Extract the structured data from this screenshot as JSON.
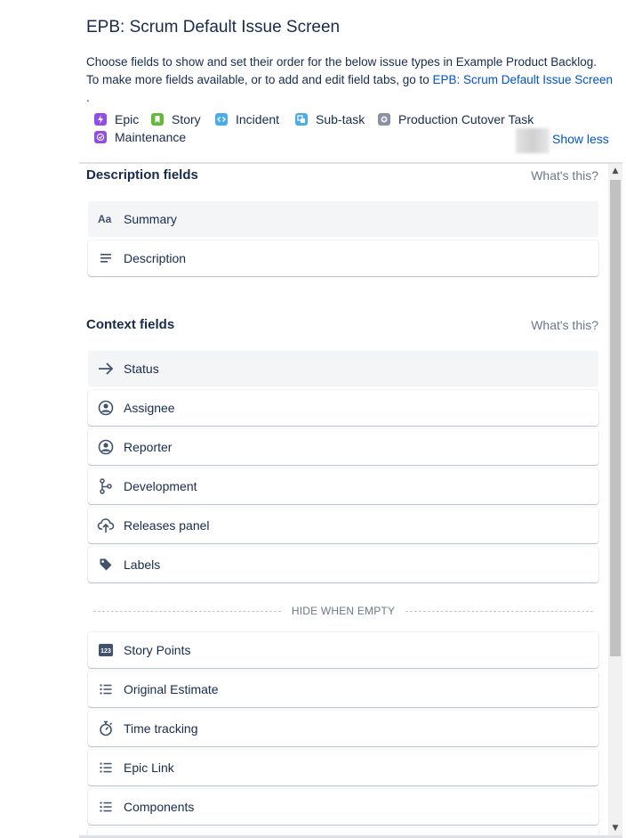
{
  "header": {
    "title": "EPB: Scrum Default Issue Screen",
    "intro_line1": "Choose fields to show and set their order for the below issue types in Example Product Backlog.",
    "intro_line2_prefix": "To make more fields available, or to add and edit field tabs, go to ",
    "intro_link": "EPB: Scrum Default Issue Screen",
    "intro_suffix": "."
  },
  "issue_types": [
    {
      "label": "Epic",
      "icon": "epic-icon",
      "color": "#904ee2"
    },
    {
      "label": "Story",
      "icon": "story-icon",
      "color": "#63ba3c"
    },
    {
      "label": "Incident",
      "icon": "incident-icon",
      "color": "#4bade8"
    },
    {
      "label": "Sub-task",
      "icon": "subtask-icon",
      "color": "#4bade8"
    },
    {
      "label": "Production Cutover Task",
      "icon": "task-icon",
      "color": "#8993a4"
    },
    {
      "label": "Maintenance",
      "icon": "maintenance-icon",
      "color": "#904ee2"
    }
  ],
  "show_less": "Show less",
  "description_section": {
    "title": "Description fields",
    "help": "What's this?",
    "fields": [
      {
        "label": "Summary",
        "icon": "text-format-icon"
      },
      {
        "label": "Description",
        "icon": "align-left-icon"
      }
    ]
  },
  "context_section": {
    "title": "Context fields",
    "help": "What's this?",
    "fields": [
      {
        "label": "Status",
        "icon": "arrow-right-icon"
      },
      {
        "label": "Assignee",
        "icon": "person-icon"
      },
      {
        "label": "Reporter",
        "icon": "person-icon"
      },
      {
        "label": "Development",
        "icon": "branch-icon"
      },
      {
        "label": "Releases panel",
        "icon": "cloud-upload-icon"
      },
      {
        "label": "Labels",
        "icon": "tag-icon"
      }
    ],
    "hide_when_empty": "HIDE WHEN EMPTY",
    "hidden_fields": [
      {
        "label": "Story Points",
        "icon": "number-icon",
        "badge": "123"
      },
      {
        "label": "Original Estimate",
        "icon": "list-icon"
      },
      {
        "label": "Time tracking",
        "icon": "stopwatch-icon"
      },
      {
        "label": "Epic Link",
        "icon": "list-icon"
      },
      {
        "label": "Components",
        "icon": "list-icon"
      }
    ]
  }
}
